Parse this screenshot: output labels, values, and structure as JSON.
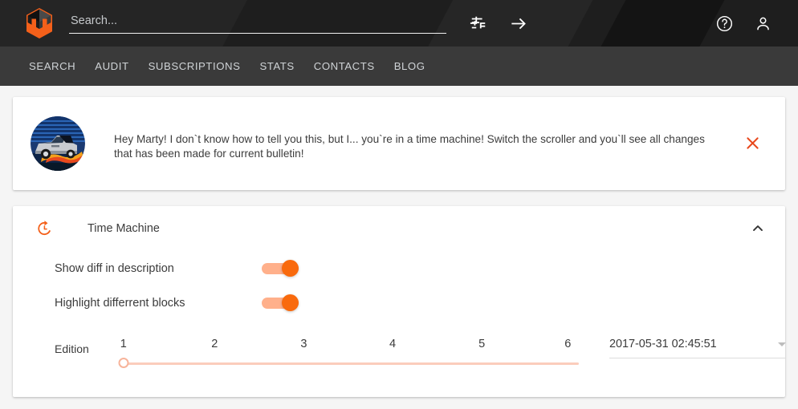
{
  "header": {
    "logo_icon": "uniform-hexagon-logo",
    "search": {
      "placeholder": "Search...",
      "value": ""
    },
    "icons": [
      {
        "name": "tune-icon",
        "label": "Filters"
      },
      {
        "name": "arrow-forward-icon",
        "label": "Submit"
      },
      {
        "name": "help-circle-icon",
        "label": "Help"
      },
      {
        "name": "person-icon",
        "label": "Account"
      }
    ],
    "accent_color": "#f4601a",
    "background_color": "#1e1e1e"
  },
  "nav": {
    "background_color": "#3a3a3a",
    "items": [
      {
        "label": "SEARCH"
      },
      {
        "label": "AUDIT"
      },
      {
        "label": "SUBSCRIPTIONS"
      },
      {
        "label": "STATS"
      },
      {
        "label": "CONTACTS"
      },
      {
        "label": "BLOG"
      }
    ]
  },
  "banner": {
    "avatar_icon": "delorean-time-machine-avatar",
    "message": "Hey Marty! I don`t know how to tell you this, but I... you`re in a time machine! Switch the scroller and you`ll see all changes that has been made for current bulletin!",
    "close_icon": "close-icon",
    "close_color": "#e8491d"
  },
  "time_machine": {
    "icon": "history-restore-icon",
    "title": "Time Machine",
    "collapse_icon": "chevron-up-icon",
    "expanded": true,
    "toggles": [
      {
        "label": "Show diff in description",
        "value": "on"
      },
      {
        "label": "Highlight differrent blocks",
        "value": "on"
      }
    ],
    "slider": {
      "caption": "Edition",
      "ticks": [
        "1",
        "2",
        "3",
        "4",
        "5",
        "6"
      ],
      "min": 1,
      "max": 6,
      "value": 1,
      "track_color": "#fbcdbc"
    },
    "datepicker": {
      "value": "2017-05-31 02:45:51",
      "caret_icon": "chevron-down-icon"
    },
    "toggle_on_color": "#f96a0d",
    "toggle_track_color": "#ffb08b"
  }
}
